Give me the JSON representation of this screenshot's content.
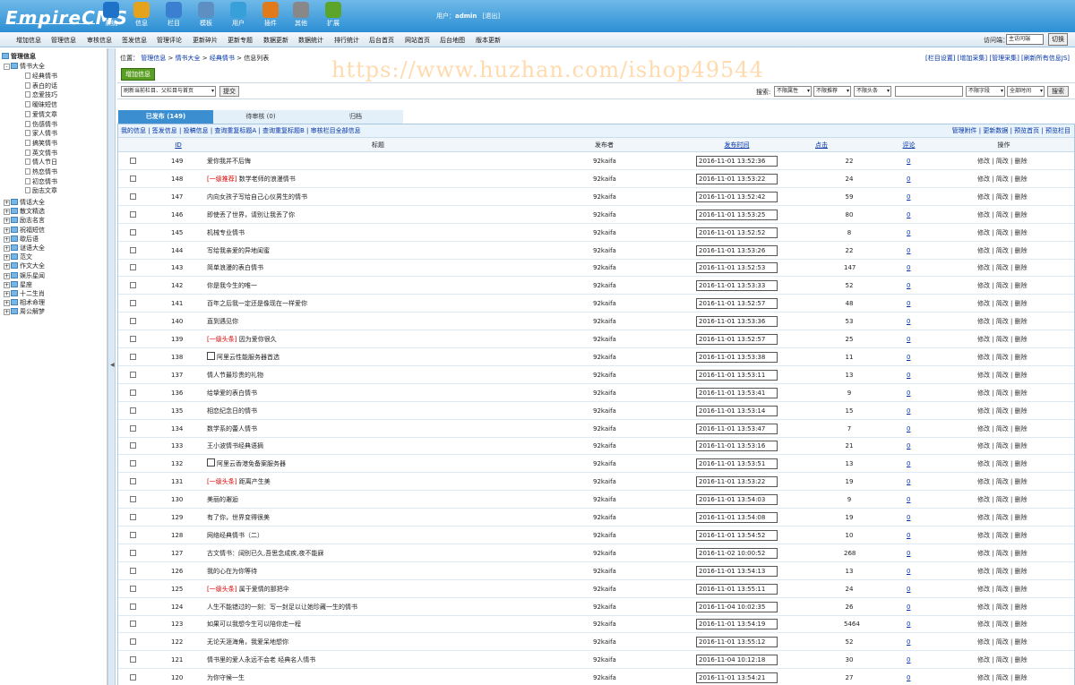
{
  "header": {
    "logo": "EmpireCMS",
    "nav": [
      "系统",
      "信息",
      "栏目",
      "模板",
      "用户",
      "插件",
      "其他",
      "扩展"
    ],
    "nav_colors": [
      "#1e73c8",
      "#e5a21c",
      "#3a7fd0",
      "#5e8fc2",
      "#38a0d8",
      "#e07a1a",
      "#888888",
      "#5aa52a"
    ],
    "user_label": "用户：",
    "user_name": "admin",
    "logout": "[退出]"
  },
  "menubar": {
    "items": [
      "增加信息",
      "管理信息",
      "审核信息",
      "签发信息",
      "管理评论",
      "更新碎片",
      "更新专题",
      "数据更新",
      "数据统计",
      "排行统计",
      "后台首页",
      "网站首页",
      "后台地图",
      "版本更新"
    ],
    "visit_label": "访问端：",
    "visit_value": "主访问端",
    "switch": "切换"
  },
  "sidebar": {
    "title": "管理信息",
    "root": "情书大全",
    "children": [
      "经典情书",
      "表白的话",
      "恋爱技巧",
      "暧昧短信",
      "爱情文章",
      "伤感情书",
      "家人情书",
      "搞笑情书",
      "英文情书",
      "情人节日",
      "热恋情书",
      "初恋情书",
      "励志文章"
    ],
    "others": [
      "情话大全",
      "散文精选",
      "励志名言",
      "祝福短信",
      "歇后语",
      "谜语大全",
      "范文",
      "作文大全",
      "娱乐星闻",
      "星座",
      "十二生肖",
      "相术命理",
      "周公解梦"
    ]
  },
  "main": {
    "location_label": "位置：",
    "breadcrumb": [
      "管理信息",
      "情书大全",
      "经典情书",
      "信息列表"
    ],
    "right_links": "[栏目设置] [增加采集] [管理采集] [刷新所有信息JS]",
    "add_button": "增加信息",
    "refresh_select": "刷新当前栏目、父栏目与首页",
    "submit": "提交",
    "search_label": "搜索:",
    "search_selects": [
      "不限属性",
      "不限推荐",
      "不限头条"
    ],
    "field_select": "不限字段",
    "time_select": "全部时间",
    "search_button": "搜索",
    "tabs": [
      "已发布 (149)",
      "待审核 (0)",
      "归档"
    ],
    "toolbar_left": "我的信息 | 签发信息 | 投稿信息 | 查询重复标题A | 查询重复标题B | 审核栏目全部信息",
    "toolbar_right": "管理附件 | 更新数据 | 预览首页 | 预览栏目",
    "columns": {
      "id": "ID",
      "title": "标题",
      "publisher": "发布者",
      "time": "发布时间",
      "clicks": "点击",
      "comments": "评论",
      "ops": "操作"
    },
    "ops_text": "修改 | 简改 | 删除"
  },
  "watermark": "https://www.huzhan.com/ishop49544",
  "rows": [
    {
      "id": "149",
      "tag": "",
      "title": "爱你我并不后悔",
      "publisher": "92kaifa",
      "time": "2016-11-01 13:52:36",
      "clicks": "22",
      "comments": "0",
      "icon": false
    },
    {
      "id": "148",
      "tag": "[一级推荐]",
      "title": "数学老师的浪漫情书",
      "publisher": "92kaifa",
      "time": "2016-11-01 13:53:22",
      "clicks": "24",
      "comments": "0",
      "icon": false
    },
    {
      "id": "147",
      "tag": "",
      "title": "内向女孩子写给自己心仪男生的情书",
      "publisher": "92kaifa",
      "time": "2016-11-01 13:52:42",
      "clicks": "59",
      "comments": "0",
      "icon": false
    },
    {
      "id": "146",
      "tag": "",
      "title": "即使丢了世界，请别让我丢了你",
      "publisher": "92kaifa",
      "time": "2016-11-01 13:53:25",
      "clicks": "80",
      "comments": "0",
      "icon": false
    },
    {
      "id": "145",
      "tag": "",
      "title": "机械专业情书",
      "publisher": "92kaifa",
      "time": "2016-11-01 13:52:52",
      "clicks": "8",
      "comments": "0",
      "icon": false
    },
    {
      "id": "144",
      "tag": "",
      "title": "写给我亲爱的异地闺蜜",
      "publisher": "92kaifa",
      "time": "2016-11-01 13:53:26",
      "clicks": "22",
      "comments": "0",
      "icon": false
    },
    {
      "id": "143",
      "tag": "",
      "title": "简单浪漫的表白情书",
      "publisher": "92kaifa",
      "time": "2016-11-01 13:52:53",
      "clicks": "147",
      "comments": "0",
      "icon": false
    },
    {
      "id": "142",
      "tag": "",
      "title": "你是我今生的唯一",
      "publisher": "92kaifa",
      "time": "2016-11-01 13:53:33",
      "clicks": "52",
      "comments": "0",
      "icon": false
    },
    {
      "id": "141",
      "tag": "",
      "title": "百年之后我一定还是像现在一样爱你",
      "publisher": "92kaifa",
      "time": "2016-11-01 13:52:57",
      "clicks": "48",
      "comments": "0",
      "icon": false
    },
    {
      "id": "140",
      "tag": "",
      "title": "直到遇见你",
      "publisher": "92kaifa",
      "time": "2016-11-01 13:53:36",
      "clicks": "53",
      "comments": "0",
      "icon": false
    },
    {
      "id": "139",
      "tag": "[一级头条]",
      "title": "因为爱你很久",
      "publisher": "92kaifa",
      "time": "2016-11-01 13:52:57",
      "clicks": "25",
      "comments": "0",
      "icon": false
    },
    {
      "id": "138",
      "tag": "",
      "title": "阿里云性能服务器首选",
      "publisher": "92kaifa",
      "time": "2016-11-01 13:53:38",
      "clicks": "11",
      "comments": "0",
      "icon": true
    },
    {
      "id": "137",
      "tag": "",
      "title": "情人节最珍贵的礼物",
      "publisher": "92kaifa",
      "time": "2016-11-01 13:53:11",
      "clicks": "13",
      "comments": "0",
      "icon": false
    },
    {
      "id": "136",
      "tag": "",
      "title": "给挚爱的表白情书",
      "publisher": "92kaifa",
      "time": "2016-11-01 13:53:41",
      "clicks": "9",
      "comments": "0",
      "icon": false
    },
    {
      "id": "135",
      "tag": "",
      "title": "相恋纪念日的情书",
      "publisher": "92kaifa",
      "time": "2016-11-01 13:53:14",
      "clicks": "15",
      "comments": "0",
      "icon": false
    },
    {
      "id": "134",
      "tag": "",
      "title": "数学系的蕾人情书",
      "publisher": "92kaifa",
      "time": "2016-11-01 13:53:47",
      "clicks": "7",
      "comments": "0",
      "icon": false
    },
    {
      "id": "133",
      "tag": "",
      "title": "王小波情书经典语摘",
      "publisher": "92kaifa",
      "time": "2016-11-01 13:53:16",
      "clicks": "21",
      "comments": "0",
      "icon": false
    },
    {
      "id": "132",
      "tag": "",
      "title": "阿里云香港免备案服务器",
      "publisher": "92kaifa",
      "time": "2016-11-01 13:53:51",
      "clicks": "13",
      "comments": "0",
      "icon": true
    },
    {
      "id": "131",
      "tag": "[一级头条]",
      "title": "距离产生美",
      "publisher": "92kaifa",
      "time": "2016-11-01 13:53:22",
      "clicks": "19",
      "comments": "0",
      "icon": false
    },
    {
      "id": "130",
      "tag": "",
      "title": "美丽的邂逅",
      "publisher": "92kaifa",
      "time": "2016-11-01 13:54:03",
      "clicks": "9",
      "comments": "0",
      "icon": false
    },
    {
      "id": "129",
      "tag": "",
      "title": "有了你，世界变得很美",
      "publisher": "92kaifa",
      "time": "2016-11-01 13:54:08",
      "clicks": "19",
      "comments": "0",
      "icon": false
    },
    {
      "id": "128",
      "tag": "",
      "title": "网络经典情书（二）",
      "publisher": "92kaifa",
      "time": "2016-11-01 13:54:52",
      "clicks": "10",
      "comments": "0",
      "icon": false
    },
    {
      "id": "127",
      "tag": "",
      "title": "古文情书：阔别已久,吾思念成疾,夜不能寐",
      "publisher": "92kaifa",
      "time": "2016-11-02 10:00:52",
      "clicks": "268",
      "comments": "0",
      "icon": false
    },
    {
      "id": "126",
      "tag": "",
      "title": "我的心在为你等待",
      "publisher": "92kaifa",
      "time": "2016-11-01 13:54:13",
      "clicks": "13",
      "comments": "0",
      "icon": false
    },
    {
      "id": "125",
      "tag": "[一级头条]",
      "title": "属于爱情的那把伞",
      "publisher": "92kaifa",
      "time": "2016-11-01 13:55:11",
      "clicks": "24",
      "comments": "0",
      "icon": false
    },
    {
      "id": "124",
      "tag": "",
      "title": "人生不能错过的一刻：写一封足以让她珍藏一生的情书",
      "publisher": "92kaifa",
      "time": "2016-11-04 10:02:35",
      "clicks": "26",
      "comments": "0",
      "icon": false
    },
    {
      "id": "123",
      "tag": "",
      "title": "如果可以我想今生可以陪你走一程",
      "publisher": "92kaifa",
      "time": "2016-11-01 13:54:19",
      "clicks": "5464",
      "comments": "0",
      "icon": false
    },
    {
      "id": "122",
      "tag": "",
      "title": "无论天涯海角，我爱呆地想你",
      "publisher": "92kaifa",
      "time": "2016-11-01 13:55:12",
      "clicks": "52",
      "comments": "0",
      "icon": false
    },
    {
      "id": "121",
      "tag": "",
      "title": "情书里的爱人永远不会老 经典名人情书",
      "publisher": "92kaifa",
      "time": "2016-11-04 10:12:18",
      "clicks": "30",
      "comments": "0",
      "icon": false
    },
    {
      "id": "120",
      "tag": "",
      "title": "为你守候一生",
      "publisher": "92kaifa",
      "time": "2016-11-01 13:54:21",
      "clicks": "27",
      "comments": "0",
      "icon": false
    }
  ]
}
